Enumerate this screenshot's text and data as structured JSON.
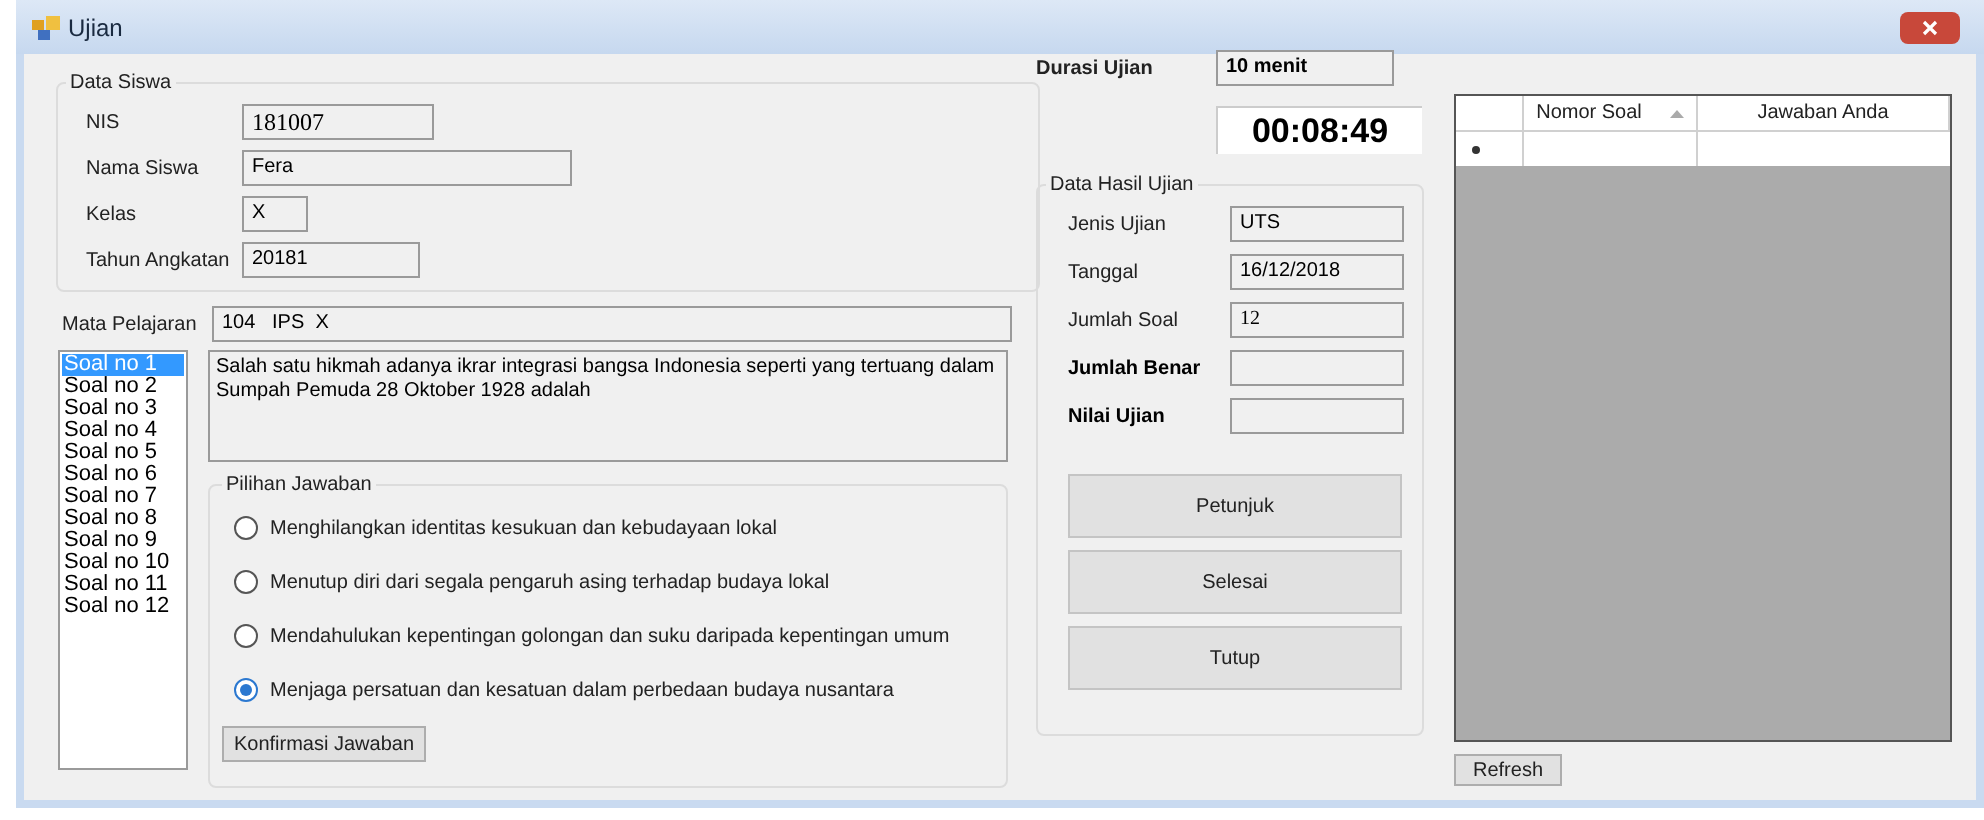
{
  "window": {
    "title": "Ujian"
  },
  "data_siswa": {
    "title": "Data Siswa",
    "fields": [
      {
        "label": "NIS",
        "value": "181007"
      },
      {
        "label": "Nama Siswa",
        "value": "Fera"
      },
      {
        "label": "Kelas",
        "value": "X"
      },
      {
        "label": "Tahun Angkatan",
        "value": "20181"
      }
    ]
  },
  "mata_pelajaran": {
    "label": "Mata Pelajaran",
    "value": "104   IPS  X"
  },
  "question_list": [
    {
      "label": "Soal no 1",
      "selected": true
    },
    {
      "label": "Soal no 2",
      "selected": false
    },
    {
      "label": "Soal no 3",
      "selected": false
    },
    {
      "label": "Soal no 4",
      "selected": false
    },
    {
      "label": "Soal no 5",
      "selected": false
    },
    {
      "label": "Soal no 6",
      "selected": false
    },
    {
      "label": "Soal no 7",
      "selected": false
    },
    {
      "label": "Soal no 8",
      "selected": false
    },
    {
      "label": "Soal no 9",
      "selected": false
    },
    {
      "label": "Soal no 10",
      "selected": false
    },
    {
      "label": "Soal no 11",
      "selected": false
    },
    {
      "label": "Soal no 12",
      "selected": false
    }
  ],
  "question_text": "Salah satu hikmah adanya ikrar integrasi bangsa Indonesia seperti yang tertuang dalam Sumpah Pemuda 28 Oktober 1928 adalah",
  "pilihan_jawaban": {
    "title": "Pilihan Jawaban",
    "options": [
      {
        "label": "Menghilangkan identitas kesukuan dan kebudayaan lokal",
        "selected": false
      },
      {
        "label": "Menutup diri dari segala pengaruh asing terhadap budaya lokal",
        "selected": false
      },
      {
        "label": "Mendahulukan kepentingan golongan dan suku daripada kepentingan umum",
        "selected": false
      },
      {
        "label": "Menjaga persatuan dan kesatuan dalam perbedaan budaya nusantara",
        "selected": true
      }
    ],
    "confirm_button": "Konfirmasi Jawaban"
  },
  "durasi": {
    "label": "Durasi Ujian",
    "value": "10 menit"
  },
  "timer": "00:08:49",
  "data_hasil": {
    "title": "Data Hasil Ujian",
    "fields": [
      {
        "label": "Jenis Ujian",
        "value": "UTS",
        "bold": false
      },
      {
        "label": "Tanggal",
        "value": "16/12/2018",
        "bold": false
      },
      {
        "label": "Jumlah Soal",
        "value": "12",
        "bold": false
      },
      {
        "label": "Jumlah Benar",
        "bold": true
      },
      {
        "label": "Nilai Ujian",
        "bold": true
      }
    ]
  },
  "buttons": [
    "Petunjuk",
    "Selesai",
    "Tutup"
  ],
  "grid": {
    "columns": [
      {
        "label": "Nomor Soal",
        "sorted": true
      },
      {
        "label": "Jawaban Anda",
        "sorted": false
      }
    ]
  },
  "refresh_button": "Refresh"
}
